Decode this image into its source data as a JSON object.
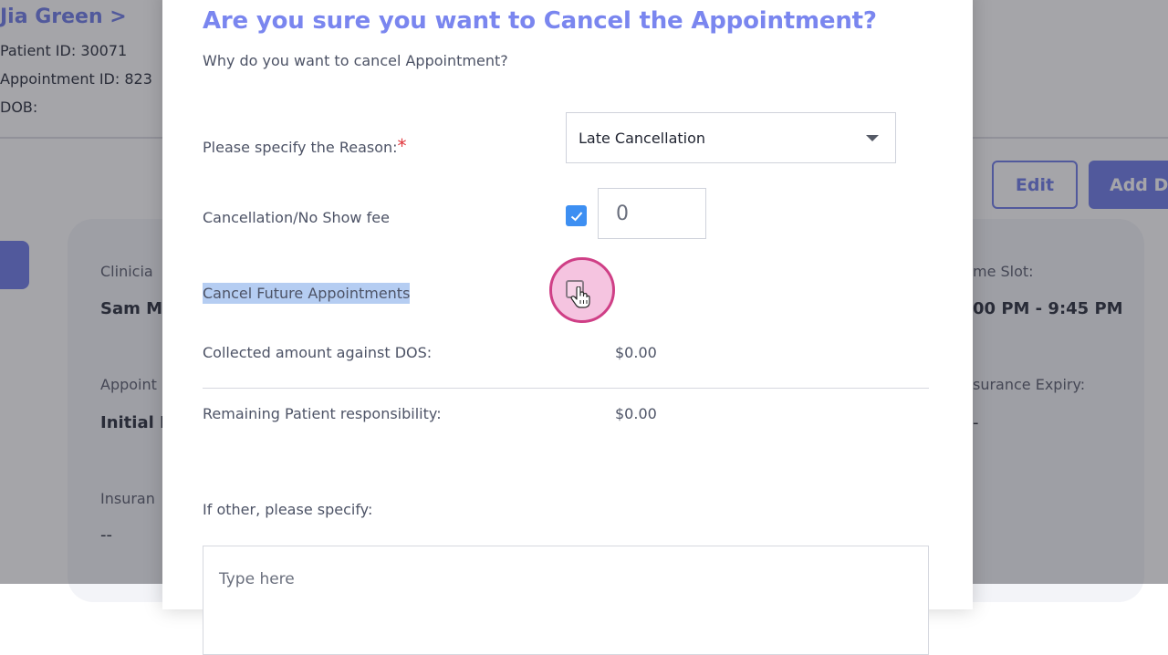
{
  "background": {
    "patient_name": "Jia Green >",
    "patient_id": "Patient ID: 30071",
    "appointment_id": "Appointment ID: 823",
    "dob": "DOB:",
    "edit_label": "Edit",
    "add_label": "Add D",
    "clinician_label": "Clinicia",
    "clinician_value": "Sam M",
    "time_slot_label": "me Slot:",
    "time_slot_value": "00 PM - 9:45 PM",
    "appointment_label": "Appoint",
    "appointment_value": "Initial E",
    "insurance_expiry_label": "surance Expiry:",
    "insurance_expiry_value": "-",
    "insurance_label": "Insuran",
    "insurance_value": "--"
  },
  "modal": {
    "title": "Are you sure you want to Cancel the Appointment?",
    "subtitle": "Why do you want to cancel Appointment?",
    "reason_label": "Please specify the Reason:",
    "required_mark": "*",
    "reason_selected": "Late Cancellation",
    "fee_label": "Cancellation/No Show fee",
    "fee_checked": true,
    "fee_value": "0",
    "cancel_future_label": "Cancel Future Appointments",
    "cancel_future_checked": false,
    "collected_label": "Collected amount against DOS:",
    "collected_value": "$0.00",
    "remaining_label": "Remaining Patient responsibility:",
    "remaining_value": "$0.00",
    "other_label": "If other, please specify:",
    "other_placeholder": "Type here"
  },
  "colors": {
    "accent": "#6f7de8",
    "title": "#7a86ef",
    "checkbox": "#3d8ff2",
    "required": "#e0353b",
    "cursor_ring": "#cf3f86"
  },
  "icons": [
    "chevron-down-icon",
    "check-icon",
    "hand-pointer-icon"
  ]
}
